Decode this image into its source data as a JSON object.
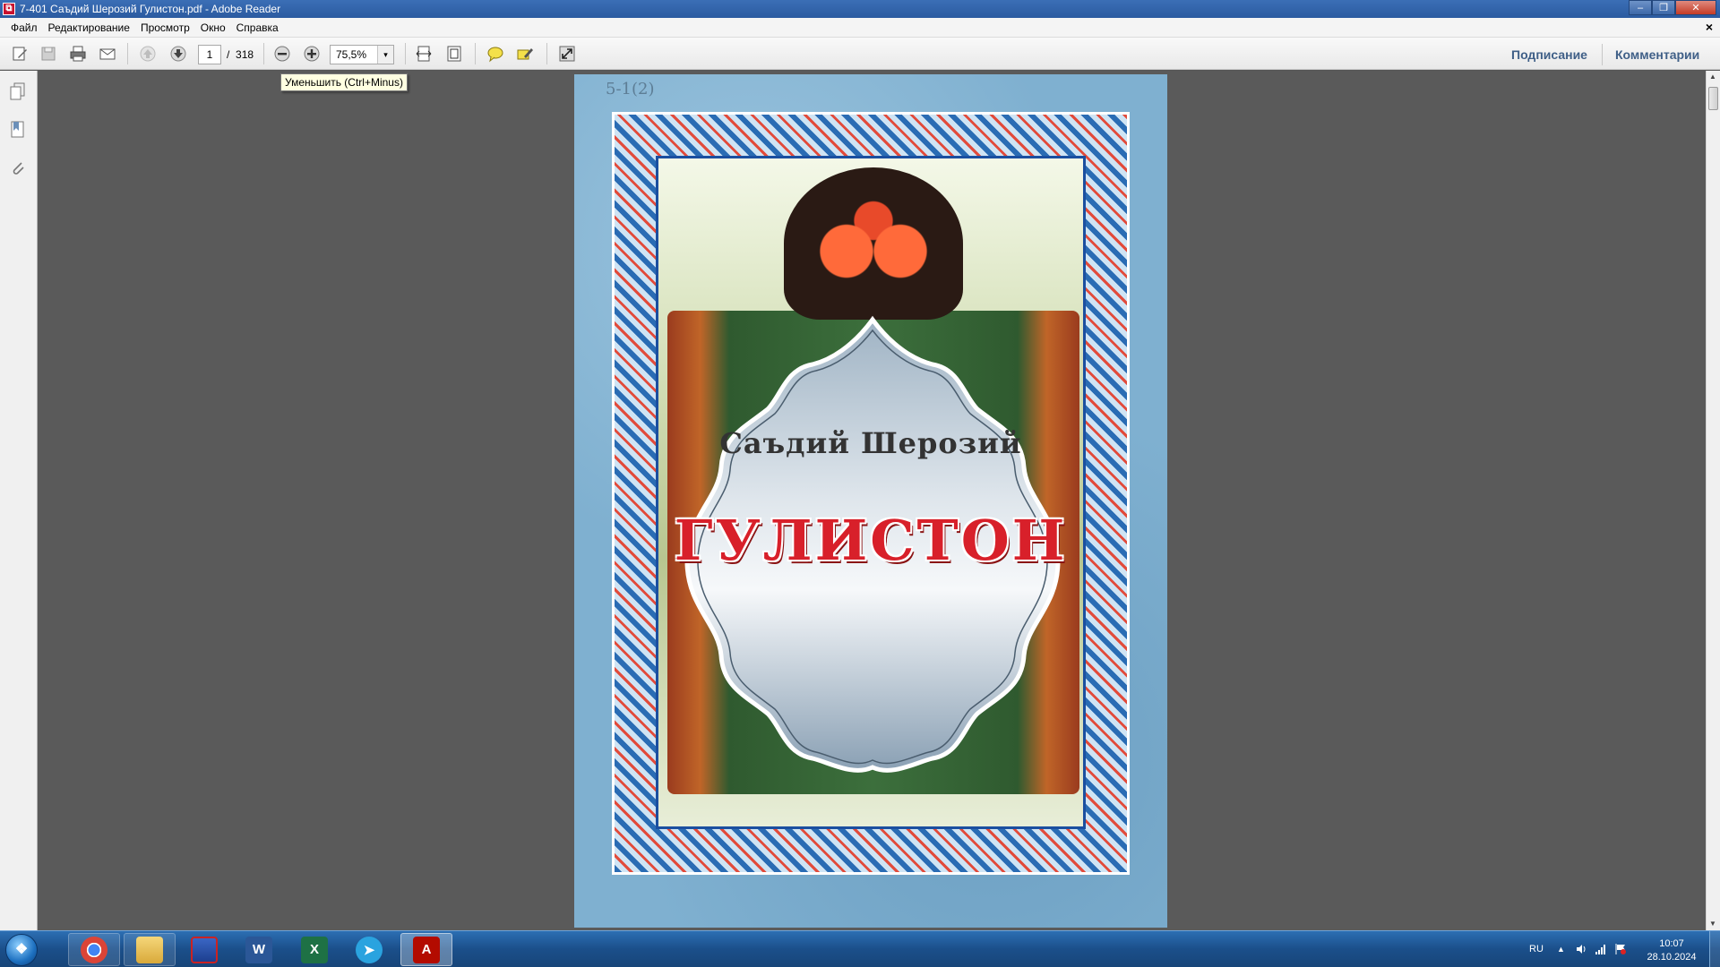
{
  "window": {
    "title": "7-401 Саъдий Шерозий Гулистон.pdf - Adobe Reader",
    "controls": {
      "minimize": "–",
      "restore": "❐",
      "close": "✕"
    },
    "doc_close": "×"
  },
  "menu": [
    "Файл",
    "Редактирование",
    "Просмотр",
    "Окно",
    "Справка"
  ],
  "toolbar": {
    "page_current": "1",
    "page_separator": "/",
    "page_total": "318",
    "zoom": "75,5%",
    "zoom_dropdown": "▾",
    "sign_link": "Подписание",
    "comments_link": "Комментарии"
  },
  "tooltip": "Уменьшить (Ctrl+Minus)",
  "document": {
    "pencil_mark": "5-1(2)",
    "author": "Саъдий Шерозий",
    "title": "ГУЛИСТОН"
  },
  "taskbar": {
    "start": "❖",
    "apps": [
      {
        "name": "chrome",
        "label": "◉"
      },
      {
        "name": "explorer",
        "label": "▭"
      },
      {
        "name": "save-app",
        "label": "▣"
      },
      {
        "name": "word",
        "label": "W"
      },
      {
        "name": "excel",
        "label": "X"
      },
      {
        "name": "telegram",
        "label": "➤"
      },
      {
        "name": "adobe-reader",
        "label": "A"
      }
    ],
    "tray": {
      "lang": "RU",
      "up_arrow": "▲",
      "time": "10:07",
      "date": "28.10.2024"
    }
  },
  "colors": {
    "title_bar": "#2b5ba0",
    "doc_background": "#5a5a5a",
    "title_red": "#d8202a",
    "link_blue": "#3f5f87"
  }
}
